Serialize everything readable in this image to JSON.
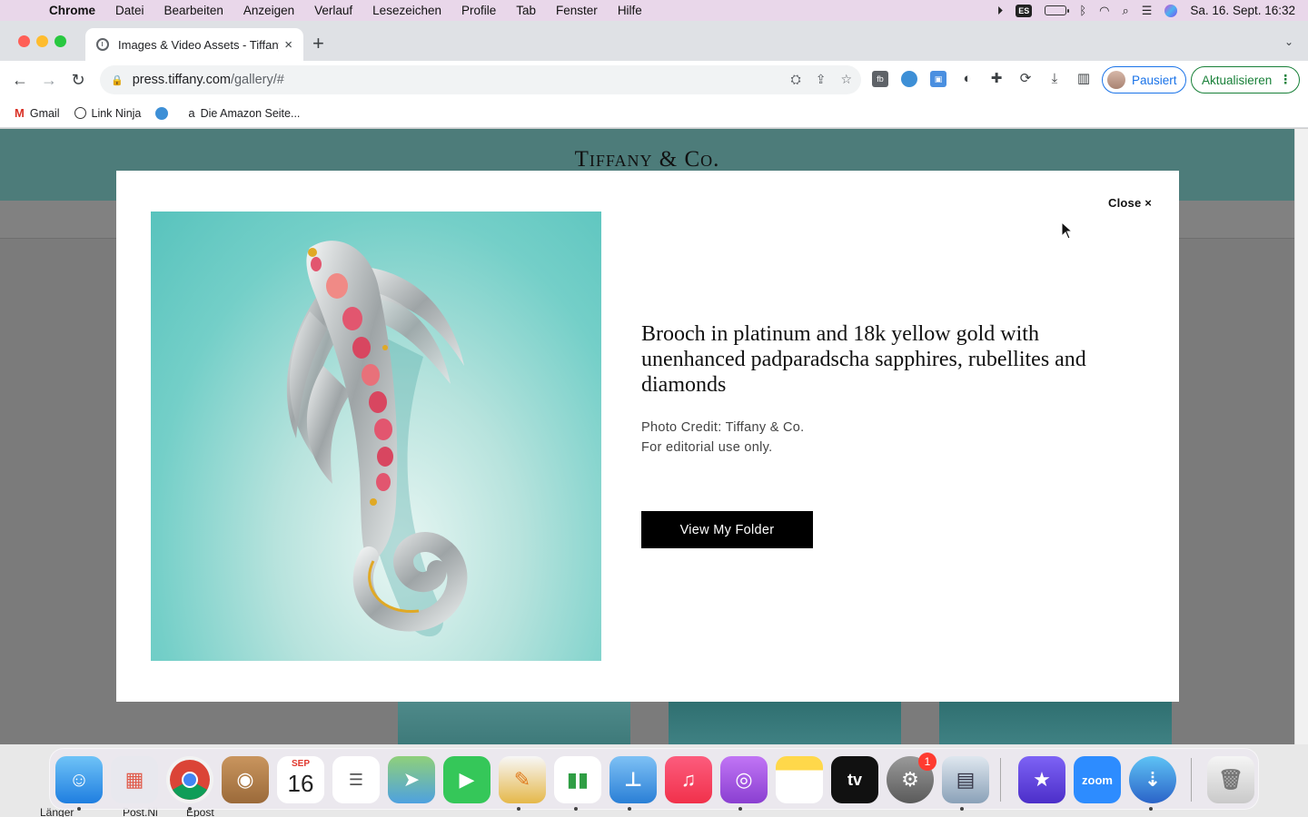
{
  "menubar": {
    "app": "Chrome",
    "items": [
      "Datei",
      "Bearbeiten",
      "Anzeigen",
      "Verlauf",
      "Lesezeichen",
      "Profile",
      "Tab",
      "Fenster",
      "Hilfe"
    ],
    "input_source": "ES",
    "datetime": "Sa. 16. Sept. 16:32"
  },
  "browser": {
    "tab_title": "Images & Video Assets - Tiffany",
    "url_host": "press.tiffany.com",
    "url_path": "/gallery/#",
    "profile_label": "Pausiert",
    "update_label": "Aktualisieren"
  },
  "bookmarks": [
    {
      "label": "Gmail",
      "icon": "gmail-icon"
    },
    {
      "label": "Link Ninja",
      "icon": "link-ninja-icon"
    },
    {
      "label": "",
      "icon": "blue-circle-icon"
    },
    {
      "label": "Die Amazon Seite...",
      "icon": "amazon-icon"
    }
  ],
  "page": {
    "logo": "Tiffany & Co."
  },
  "modal": {
    "close_label": "Close ×",
    "title": "Brooch in platinum and 18k yellow gold with unenhanced padparadscha sapphires, rubellites and diamonds",
    "credit_line1": "Photo Credit: Tiffany & Co.",
    "credit_line2": "For editorial use only.",
    "button_label": "View My Folder"
  },
  "dock": {
    "calendar_month": "SEP",
    "calendar_day": "16",
    "settings_badge": "1",
    "zoom_label": "zoom",
    "tv_label": "tv"
  },
  "behind_dock": [
    "Länger",
    "Post.Ni",
    "Epost"
  ]
}
